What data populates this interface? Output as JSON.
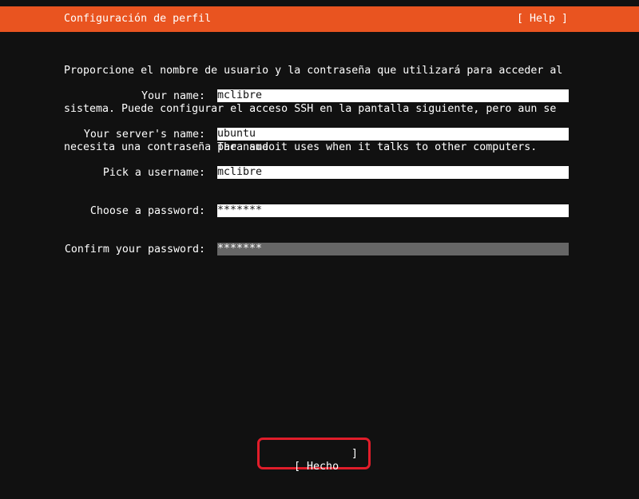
{
  "header": {
    "title": "Configuración de perfil",
    "help_label": "[ Help ]"
  },
  "intro": {
    "line1": "Proporcione el nombre de usuario y la contraseña que utilizará para acceder al",
    "line2": "sistema. Puede configurar el acceso SSH en la pantalla siguiente, pero aun se",
    "line3": "necesita una contraseña para sudo."
  },
  "form": {
    "your_name": {
      "label": "Your name:",
      "value": "mclibre"
    },
    "server_name": {
      "label": "Your server's name:",
      "value": "ubuntu",
      "hint": "The name it uses when it talks to other computers."
    },
    "username": {
      "label": "Pick a username:",
      "value": "mclibre"
    },
    "password": {
      "label": "Choose a password:",
      "value": "*******"
    },
    "confirm_password": {
      "label": "Confirm your password:",
      "value": "*******"
    }
  },
  "footer": {
    "done_open": "[ Hecho",
    "done_close": "]"
  },
  "colors": {
    "accent": "#e95420",
    "background": "#111111",
    "highlight": "#e11d2a",
    "focused_field": "#666666"
  }
}
